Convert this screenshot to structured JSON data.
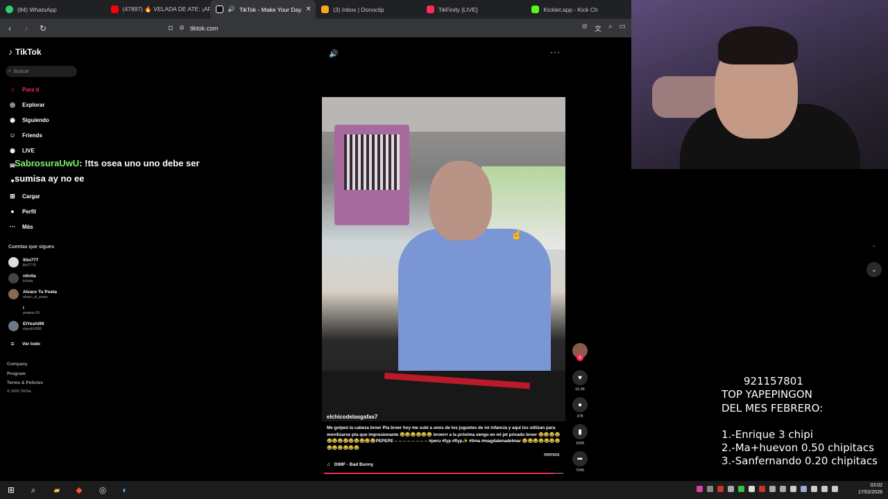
{
  "browser": {
    "tabs": [
      {
        "label": "(84) WhatsApp",
        "color": "#25d366",
        "active": false
      },
      {
        "label": "(47897) 🔥 VELADA DE ATE: ¡ARRUGU",
        "color": "#ff0000",
        "active": false
      },
      {
        "label": "TikTok - Make Your Day",
        "color": "#ffffff",
        "active": true
      },
      {
        "label": "(3) Inbox | Donoclip",
        "color": "#f5a623",
        "active": false
      },
      {
        "label": "TikFinity [LIVE]",
        "color": "#fe2c55",
        "active": false
      },
      {
        "label": "Kicklet.app - Kick Ch",
        "color": "#53fc18",
        "active": false
      }
    ],
    "url": "tiktok.com"
  },
  "sidebar": {
    "logo": "TikTok",
    "search_placeholder": "Buscar",
    "menu": [
      {
        "label": "Para ti",
        "icon": "home-icon",
        "glyph": "⌂",
        "active": true
      },
      {
        "label": "Explorar",
        "icon": "compass-icon",
        "glyph": "◎",
        "active": false
      },
      {
        "label": "Siguiendo",
        "icon": "following-icon",
        "glyph": "◉",
        "active": false
      },
      {
        "label": "Friends",
        "icon": "friends-icon",
        "glyph": "☺",
        "active": false
      },
      {
        "label": "LIVE",
        "icon": "live-icon",
        "glyph": "◉",
        "active": false
      },
      {
        "label": "Mensajes",
        "icon": "messages-icon",
        "glyph": "✉",
        "active": false
      },
      {
        "label": "Actividad",
        "icon": "activity-icon",
        "glyph": "♥",
        "active": false
      },
      {
        "label": "Cargar",
        "icon": "upload-icon",
        "glyph": "⊞",
        "active": false
      },
      {
        "label": "Perfil",
        "icon": "profile-icon",
        "glyph": "●",
        "active": false
      },
      {
        "label": "Más",
        "icon": "more-icon",
        "glyph": "···",
        "active": false
      }
    ],
    "following_title": "Cuentas que sigues",
    "following": [
      {
        "name": "llito777",
        "handle": "llito7775"
      },
      {
        "name": "n0vita",
        "handle": "in0vita"
      },
      {
        "name": "Alvaro Tu Poeta",
        "handle": "alvaro_el_poeta"
      },
      {
        "name": "i",
        "handle": "pinwino.09"
      },
      {
        "name": "ElYeshi99",
        "handle": "elyeshi1999"
      }
    ],
    "see_all": "Ver todo",
    "footer": {
      "company": "Company",
      "program": "Program",
      "terms": "Terms & Policies",
      "copyright": "© 2026 TikTok"
    }
  },
  "chat_overlay": {
    "user": "SabrosuraUwU",
    "message": ": !tts osea uno uno debe ser sumisa ay no ee"
  },
  "video": {
    "author": "elchicodelasgafas7",
    "description": "Me golpeó la cabeza broer Pta broer hoy me subí a unos de los juguetes de mi infancia y aquí los utilizan para movilizarse pta que impresionante 😂😂😂😂😂😂 broerrr a la próxima vengo en mi jet privado broer 😂😂😂😂😂😂😂😂😂😂😂😂😂PEPEPE ─ ─ ─ ─ ─ ─ ─ ─ #peru #fyp #flyp✨ #lima #magdalenadelmar 😂😂😂😂😂😂😂😂😂😂😂😂😂",
    "less": "menos",
    "music": "DtMF - Bad Bunny",
    "progress": 0.96,
    "likes": "19.3K",
    "comments": "378",
    "saves": "1669",
    "shares": "7345"
  },
  "stream": {
    "phone": "921157801",
    "title_line1": "TOP YAPEPINGON",
    "title_line2": "DEL MES FEBRERO:",
    "ranking": [
      "1.-Enrique 3 chipi",
      "2.-Ma+huevon 0.50 chipitacs",
      "3.-Sanfernando 0.20 chipitacs"
    ]
  },
  "taskbar": {
    "time": "03:02",
    "date": "17/02/2026"
  },
  "colors": {
    "accent": "#fe2c55",
    "chat_user": "#7df16f"
  }
}
